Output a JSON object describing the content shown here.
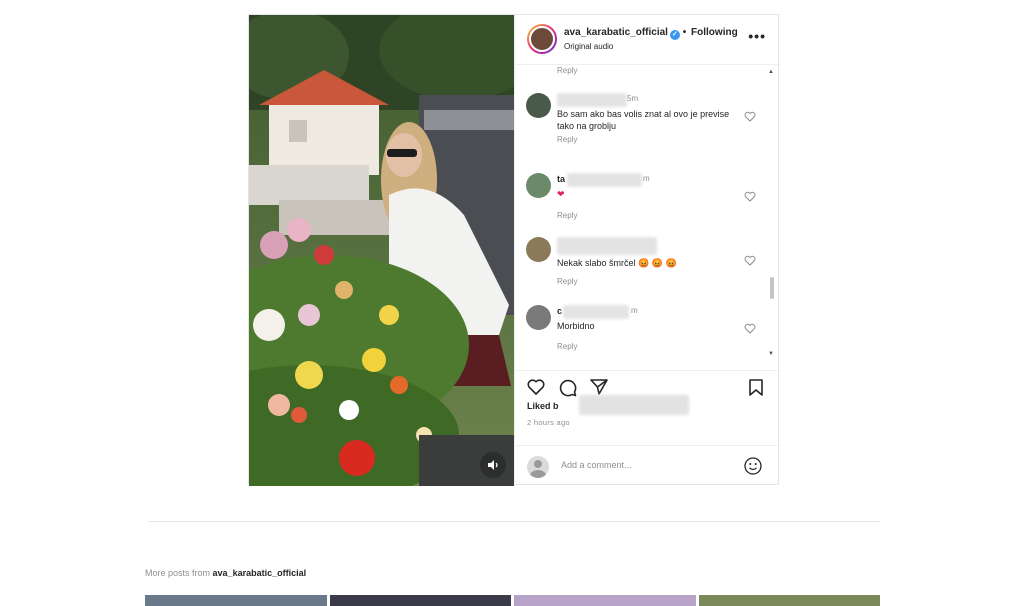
{
  "post": {
    "username": "ava_karabatic_official",
    "follow_separator": "•",
    "follow_label": "Following",
    "audio_label": "Original audio",
    "more_label": "•••",
    "top_reply_label": "Reply",
    "comments": [
      {
        "time_suffix": "5m",
        "text": "Bo sam ako bas volis znat al ovo je previse tako na groblju",
        "reply_label": "Reply",
        "avatar_color": "#4a5a48"
      },
      {
        "name_prefix": "ta",
        "time_suffix": "m",
        "text": "❤",
        "reply_label": "Reply",
        "avatar_color": "#6a8a6a"
      },
      {
        "time_suffix": "",
        "text": "Nekak slabo šmrčel 😡 😡 😡",
        "reply_label": "Reply",
        "avatar_color": "#8a7a5a"
      },
      {
        "name_prefix": "c",
        "time_suffix": "m",
        "text": "Morbidno",
        "reply_label": "Reply",
        "avatar_color": "#7a7a7a"
      }
    ],
    "liked_by_label": "Liked b",
    "timestamp": "2 hours ago",
    "add_comment_placeholder": "Add a comment..."
  },
  "more_posts": {
    "prefix": "More posts from",
    "username": "ava_karabatic_official"
  },
  "colors": {
    "link_blue": "#3897f0",
    "text": "#262626",
    "muted": "#8e8e8e",
    "heart_red": "#e0245e"
  }
}
